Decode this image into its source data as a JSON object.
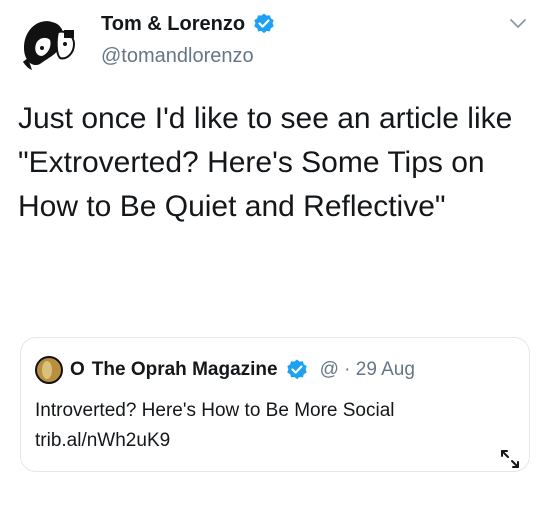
{
  "tweet": {
    "author_name": "Tom & Lorenzo",
    "handle": "@tomandlorenzo",
    "text": "Just once I'd like to see an article like \"Extroverted? Here's Some Tips on How to Be Quiet and Reflective\""
  },
  "quoted_tweet": {
    "prefix": "O",
    "author_name": "The Oprah Magazine",
    "meta": "@ · 29 Aug",
    "text": "Introverted? Here's How to Be More Social trib.al/nWh2uK9"
  },
  "icons": {
    "verified": "verified-badge-icon",
    "menu": "chevron-down-icon",
    "expand": "expand-arrows-icon"
  },
  "colors": {
    "verified_blue": "#1da1f2",
    "secondary_text": "#657786",
    "primary_text": "#14171a",
    "card_border": "#e1e8ed"
  }
}
